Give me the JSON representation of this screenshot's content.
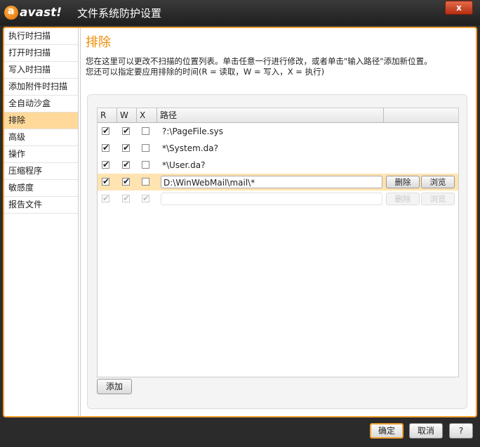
{
  "window": {
    "logo": "avast!",
    "title": "文件系统防护设置",
    "close": "x"
  },
  "sidebar": {
    "items": [
      {
        "label": "执行时扫描"
      },
      {
        "label": "打开时扫描"
      },
      {
        "label": "写入时扫描"
      },
      {
        "label": "添加附件时扫描"
      },
      {
        "label": "全自动沙盒"
      },
      {
        "label": "排除",
        "active": true
      },
      {
        "label": "高级"
      },
      {
        "label": "操作"
      },
      {
        "label": "压缩程序"
      },
      {
        "label": "敏感度"
      },
      {
        "label": "报告文件"
      }
    ]
  },
  "main": {
    "title": "排除",
    "desc1": "您在这里可以更改不扫描的位置列表。单击任意一行进行修改，或者单击\"输入路径\"添加新位置。",
    "desc2": "您还可以指定要应用排除的时间(R = 读取，W = 写入，X = 执行)",
    "columns": {
      "r": "R",
      "w": "W",
      "x": "X",
      "path": "路径"
    },
    "rows": [
      {
        "r": true,
        "w": true,
        "x": false,
        "path": "?:\\PageFile.sys"
      },
      {
        "r": true,
        "w": true,
        "x": false,
        "path": "*\\System.da?"
      },
      {
        "r": true,
        "w": true,
        "x": false,
        "path": "*\\User.da?"
      },
      {
        "r": true,
        "w": true,
        "x": false,
        "path": "D:\\WinWebMail\\mail\\*",
        "selected": true
      },
      {
        "r": true,
        "w": true,
        "x": true,
        "path": "",
        "placeholder_row": true
      }
    ],
    "delete_label": "删除",
    "browse_label": "浏览",
    "add_label": "添加"
  },
  "footer": {
    "ok": "确定",
    "cancel": "取消",
    "help": "?"
  },
  "colors": {
    "accent": "#f0a030",
    "selected_row": "#ffe3b0",
    "active_sidebar": "#ffd99a"
  }
}
